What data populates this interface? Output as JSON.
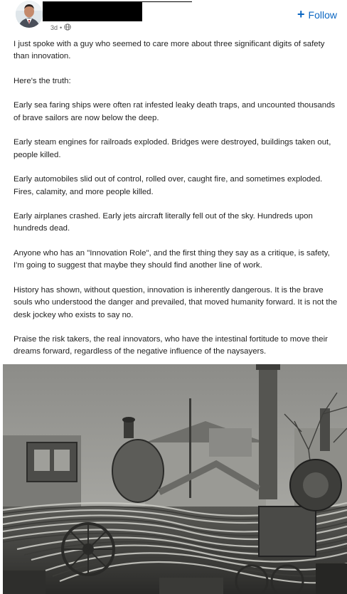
{
  "post": {
    "timestamp": "3d",
    "separator": "•",
    "visibility_icon": "globe-icon",
    "follow_label": "Follow",
    "follow_icon": "plus-icon",
    "accent_color": "#0a66c2",
    "paragraphs": [
      "I just spoke with a guy who seemed to care more about three significant digits of safety than innovation.",
      "Here's the truth:",
      "Early sea faring ships were often rat infested leaky death traps, and uncounted thousands of brave sailors are now below the deep.",
      "Early steam engines for railroads exploded. Bridges were destroyed, buildings taken out, people killed.",
      "Early automobiles slid out of control, rolled over, caught fire, and sometimes exploded. Fires, calamity, and more people killed.",
      "Early airplanes crashed. Early jets aircraft literally fell out of the sky. Hundreds upon hundreds dead.",
      "Anyone who has an \"Innovation Role\", and the first thing they say as a critique, is safety, I'm going to suggest that maybe they should find another line of work.",
      "History has shown, without question, innovation is inherently dangerous. It is the brave souls who understood the danger and prevailed, that moved humanity forward. It is not the desk jockey who exists to say no.",
      "Praise the risk takers, the real innovators, who have the intestinal fortitude to move their dreams forward, regardless of the negative influence of the naysayers."
    ]
  }
}
